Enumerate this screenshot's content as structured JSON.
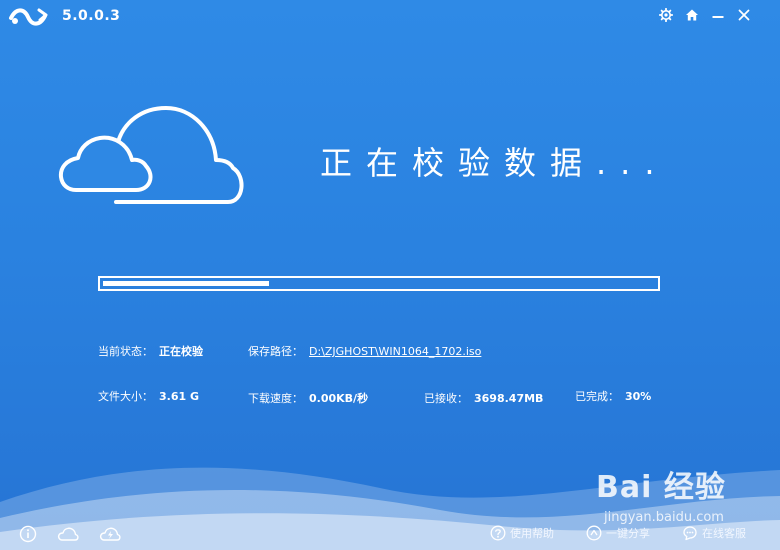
{
  "app": {
    "version": "5.0.0.3"
  },
  "window_controls": {
    "settings": "gear-icon",
    "home": "home-icon",
    "minimize": "minimize-icon",
    "close": "close-icon"
  },
  "main": {
    "status_title": "正在校验数据...",
    "progress_percent": 30
  },
  "info": {
    "current_status_label": "当前状态：",
    "current_status_value": "正在校验",
    "save_path_label": "保存路径：",
    "save_path_value": "D:\\ZJGHOST\\WIN1064_1702.iso",
    "file_size_label": "文件大小：",
    "file_size_value": "3.61 G",
    "download_speed_label": "下载速度：",
    "download_speed_value": "0.00KB/秒",
    "received_label": "已接收：",
    "received_value": "3698.47MB",
    "completed_label": "已完成：",
    "completed_value": "30%"
  },
  "bottom": {
    "help_label": "使用帮助",
    "share_label": "一键分享",
    "service_label": "在线客服"
  },
  "watermark": {
    "text": "Bai 经验",
    "sub": "jingyan.baidu.com"
  },
  "colors": {
    "background_top": "#2f8ae6",
    "background_bottom": "#2674d4",
    "foreground": "#ffffff"
  }
}
